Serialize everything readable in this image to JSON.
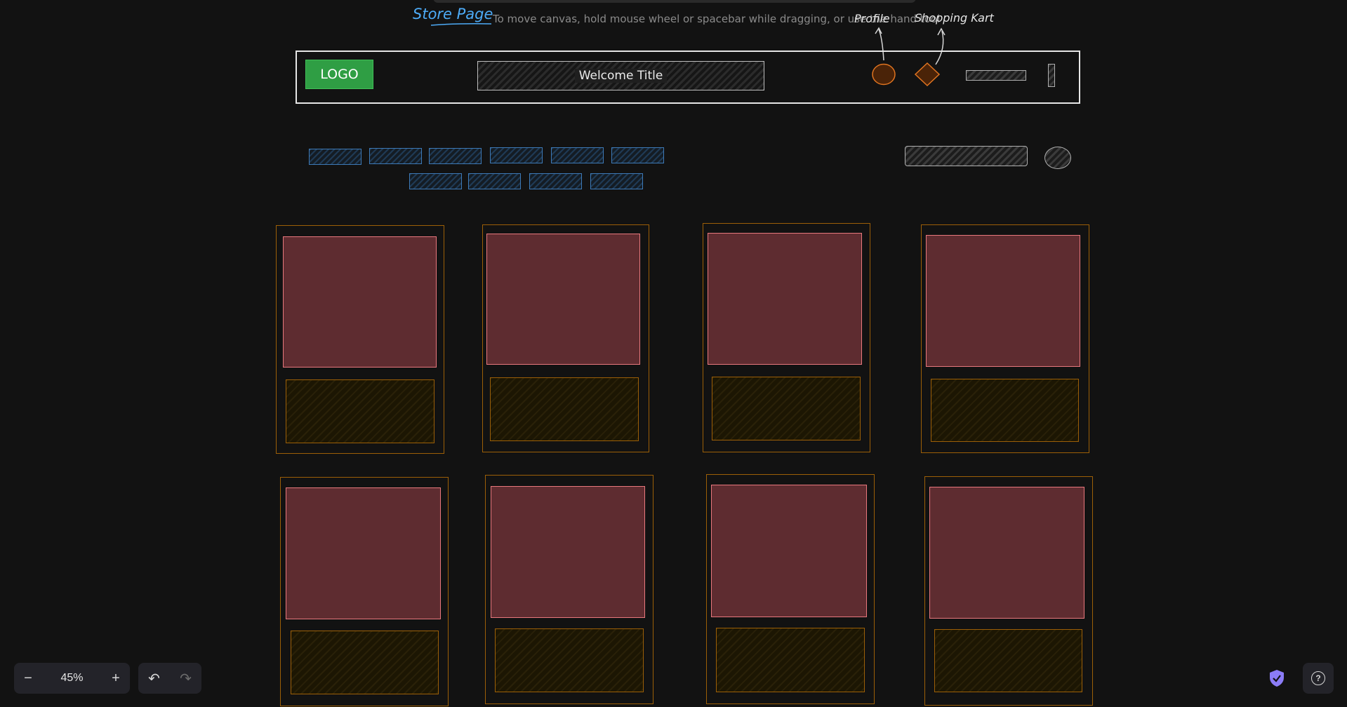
{
  "canvas": {
    "title": "Store Page",
    "hint": "To move canvas, hold mouse wheel or spacebar while dragging, or use the hand tool",
    "annotations": {
      "profile": "Profile",
      "cart": "Shopping Kart"
    }
  },
  "header": {
    "logo": "LOGO",
    "welcome": "Welcome Title"
  },
  "footer": {
    "zoom_out_icon": "−",
    "zoom_level": "45%",
    "zoom_in_icon": "+",
    "undo_icon": "↶",
    "redo_icon": "↷",
    "help_icon": "?"
  },
  "colors": {
    "background": "#121212",
    "accent_blue": "#4dabf7",
    "logo_green": "#2f9e44",
    "card_border": "#9c5f07",
    "image_fill": "#5e2c30",
    "image_border": "#e8787d",
    "profile_orange": "#c2570c"
  },
  "icons": [
    "profile-circle-icon",
    "cart-diamond-icon",
    "shield-icon",
    "help-icon"
  ]
}
